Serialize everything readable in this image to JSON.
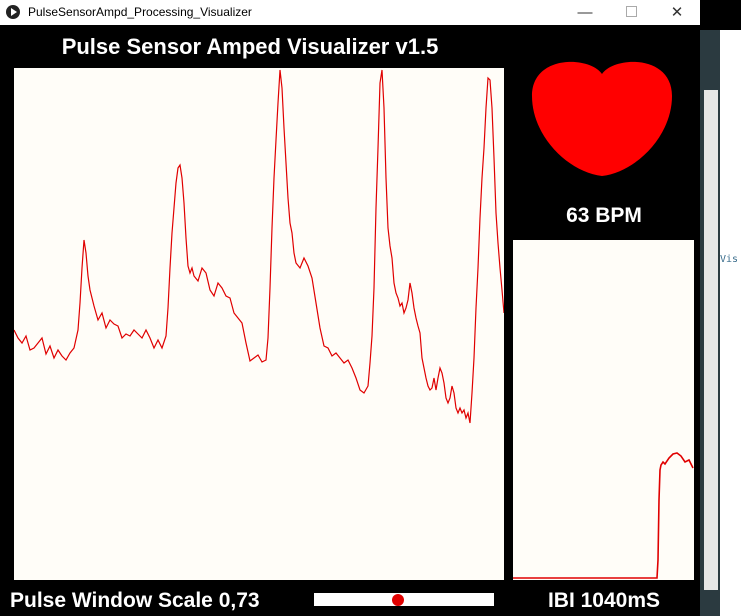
{
  "window": {
    "title": "PulseSensorAmpd_Processing_Visualizer",
    "minimize_glyph": "—",
    "close_glyph": "✕"
  },
  "heading": "Pulse Sensor Amped Visualizer v1.5",
  "bpm_text": "63 BPM",
  "scale_text": "Pulse Window Scale 0,73",
  "ibi_text": "IBI 1040mS",
  "background_app": {
    "snippet": "Vis"
  },
  "colors": {
    "trace": "#e00000",
    "plot_bg": "#fffdf8",
    "heart": "#ff0000",
    "window_bg": "#000000"
  },
  "icons": [
    "app-icon",
    "heart-icon"
  ]
}
